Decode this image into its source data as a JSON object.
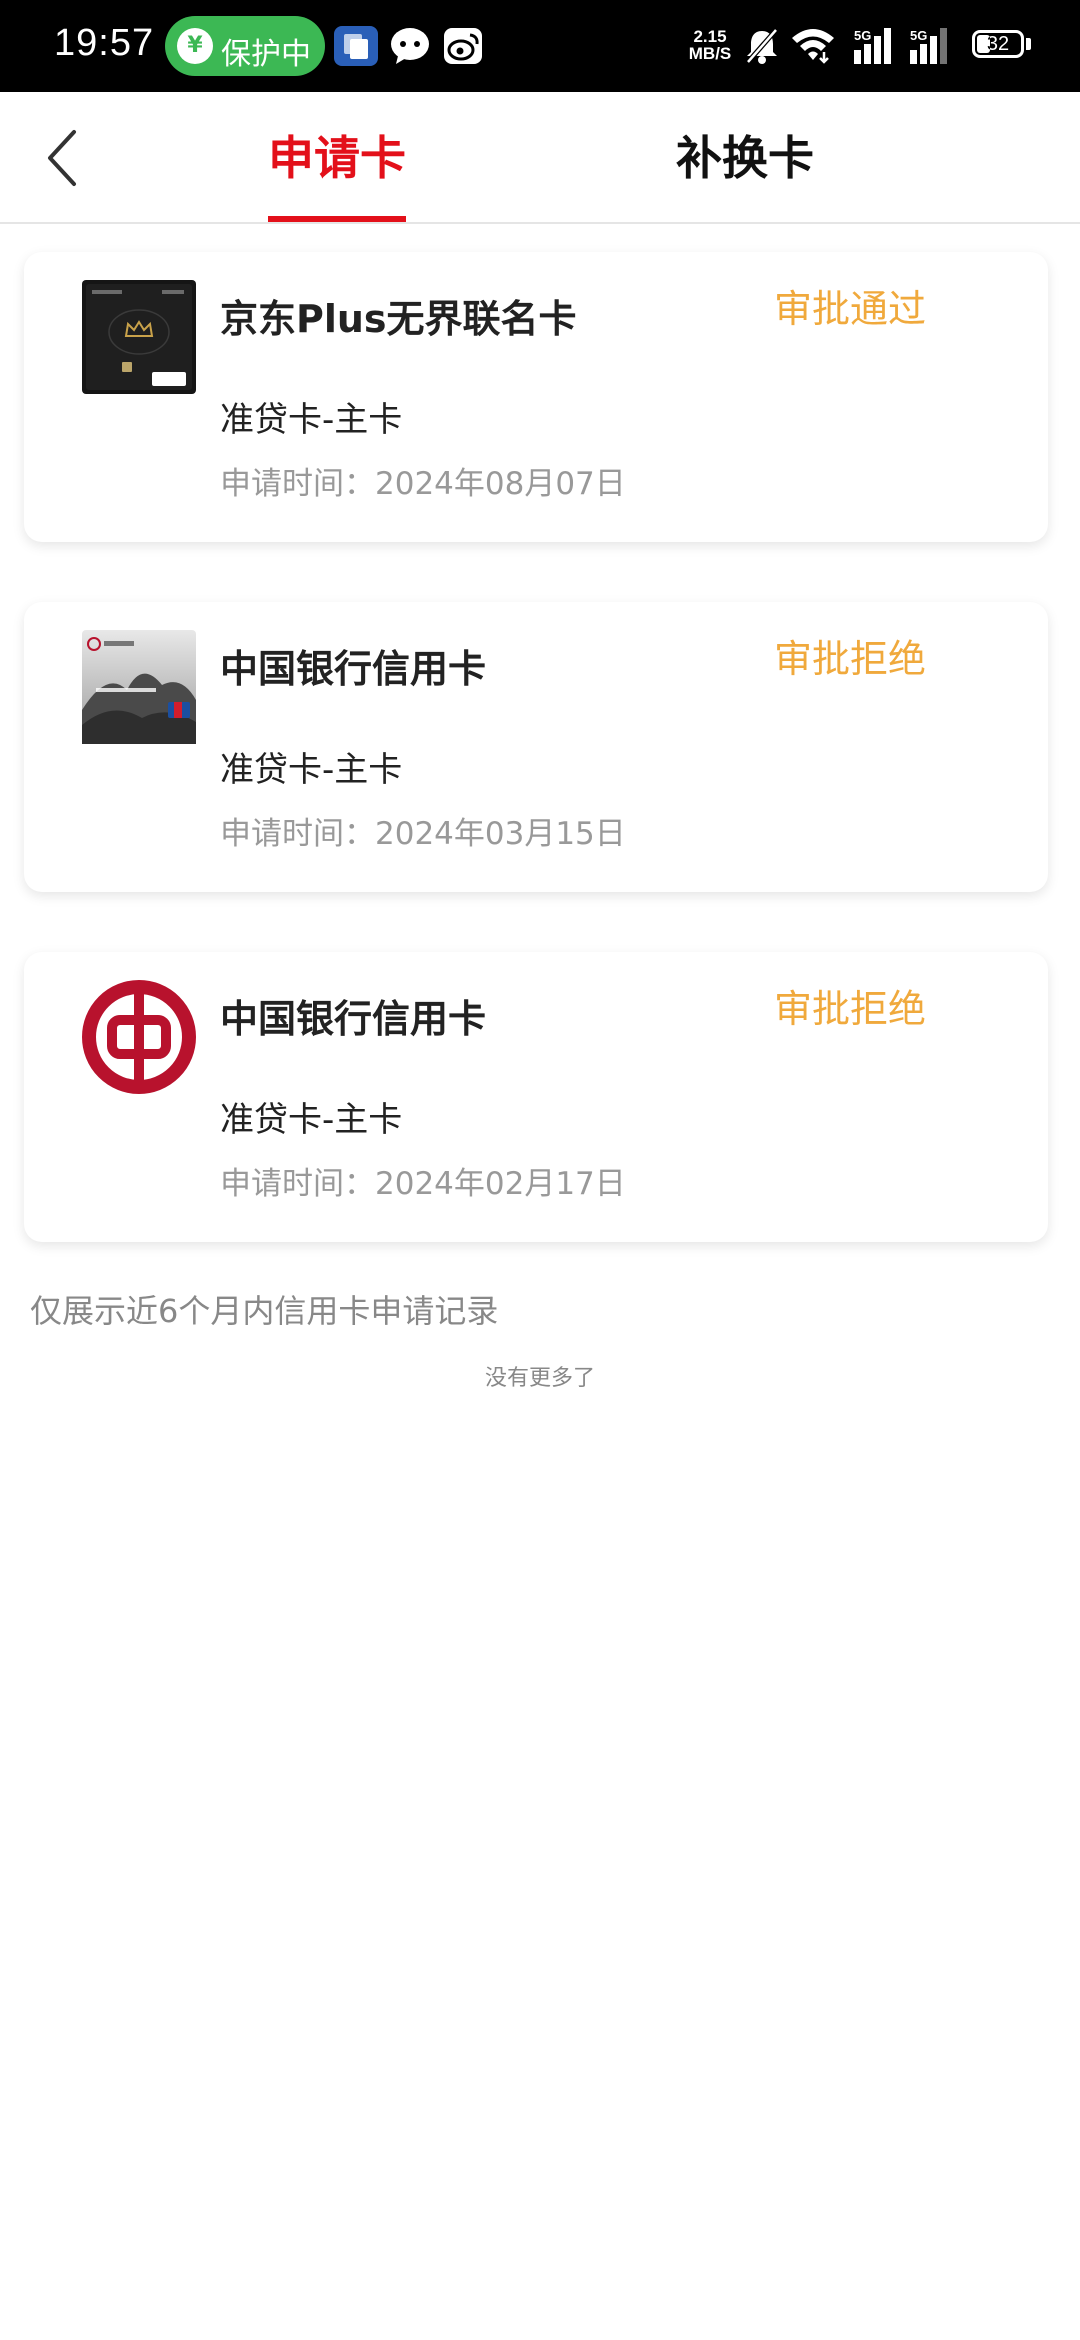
{
  "status_bar": {
    "time": "19:57",
    "protect_label": "保护中",
    "protect_glyph": "¥",
    "net_speed_value": "2.15",
    "net_speed_unit": "MB/S",
    "signal_1_label": "5G",
    "signal_2_label": "5G",
    "battery_level": "32"
  },
  "header": {
    "tabs": [
      {
        "label": "申请卡",
        "active": true
      },
      {
        "label": "补换卡",
        "active": false
      }
    ],
    "accent_color": "#e3101a"
  },
  "applications": [
    {
      "title": "京东Plus无界联名卡",
      "status": "审批通过",
      "type": "准贷卡-主卡",
      "date": "申请时间：2024年08月07日",
      "image": "jd-plus-card-image"
    },
    {
      "title": "中国银行信用卡",
      "status": "审批拒绝",
      "type": "准贷卡-主卡",
      "date": "申请时间：2024年03月15日",
      "image": "boc-card-image"
    },
    {
      "title": "中国银行信用卡",
      "status": "审批拒绝",
      "type": "准贷卡-主卡",
      "date": "申请时间：2024年02月17日",
      "image": "boc-logo"
    }
  ],
  "footer": {
    "note": "仅展示近6个月内信用卡申请记录",
    "no_more": "没有更多了"
  },
  "colors": {
    "status": "#f0a93c",
    "secondary_text": "#999999",
    "protect_green": "#3cb854"
  }
}
